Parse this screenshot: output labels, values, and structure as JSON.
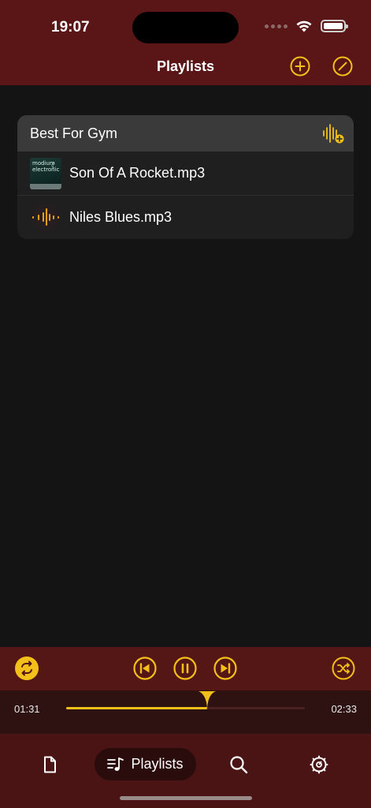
{
  "status": {
    "time": "19:07"
  },
  "nav": {
    "title": "Playlists"
  },
  "playlist": {
    "title": "Best For Gym",
    "tracks": [
      {
        "name": "Son Of A Rocket.mp3",
        "art_text": "modium electronic"
      },
      {
        "name": "Niles Blues.mp3"
      }
    ]
  },
  "player": {
    "elapsed": "01:31",
    "duration": "02:33",
    "progress": 0.59
  },
  "tabs": {
    "active_label": "Playlists"
  },
  "colors": {
    "accent": "#f3c019",
    "header": "#5a1616",
    "tabbar": "#4b1414"
  }
}
